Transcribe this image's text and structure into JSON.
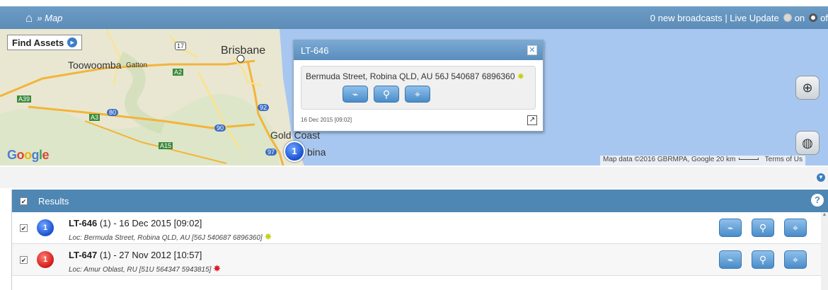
{
  "topbar": {
    "home_icon": "home-icon",
    "breadcrumb": "» Map",
    "broadcasts": "0 new broadcasts",
    "live_update_label": "| Live Update",
    "on_label": "on",
    "off_label": "of"
  },
  "map": {
    "find_assets_label": "Find Assets",
    "labels": {
      "toowoomba": "Toowoomba",
      "gatton": "Gatton",
      "brisbane": "Brisbane",
      "gold_coast": "Gold Coast",
      "robina": "bina",
      "a2": "A2",
      "a39": "A39",
      "a3": "A3",
      "a15": "A15",
      "r17": "17",
      "r80": "80",
      "r90": "90",
      "r92": "92",
      "r97": "97"
    },
    "google_letters": [
      "G",
      "o",
      "o",
      "g",
      "l",
      "e"
    ],
    "attribution": "Map data ©2016 GBRMPA, Google   20 km",
    "terms": "Terms of Us",
    "cluster_count": "1"
  },
  "popup": {
    "title": "LT-646",
    "address": "Bermuda Street, Robina QLD, AU 56J 540687 6896360",
    "date": "16 Dec 2015 [09:02]",
    "close": "✕",
    "expand": "↗"
  },
  "results": {
    "header": "Results",
    "help": "?",
    "rows": [
      {
        "badge": "1",
        "name": "LT-646",
        "rest": " (1) - 16 Dec 2015 [09:02]",
        "loc": "Loc: Bermuda Street, Robina QLD, AU [56J 540687 6896360]",
        "star_color": "#c4d21a"
      },
      {
        "badge": "1",
        "name": "LT-647",
        "rest": " (1) - 27 Nov 2012 [10:57]",
        "loc": "Loc: Amur Oblast, RU [51U 564347 5943815]",
        "star_color": "#e0191f"
      }
    ]
  },
  "colors": {
    "topbar": "#6d9dc5",
    "results_header": "#4e86b4",
    "button_blue": "#4a8cc9"
  }
}
